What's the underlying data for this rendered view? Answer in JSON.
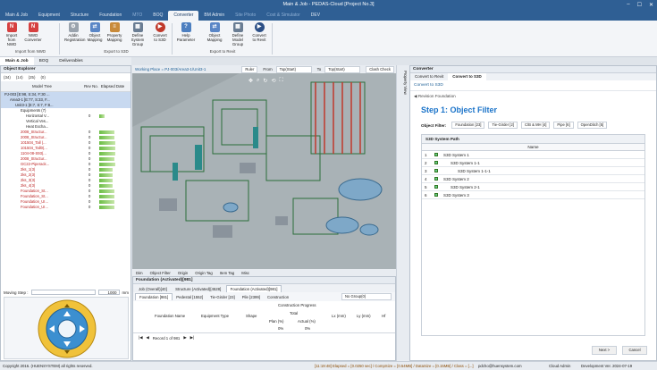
{
  "window": {
    "title": "Main & Job - PEDAS-Cloud [Project No.3]",
    "controls": [
      "–",
      "☐",
      "✕"
    ]
  },
  "menu": {
    "items": [
      "Main & Job",
      "Equipment",
      "Structure",
      "Foundation",
      "MTO",
      "BOQ",
      "Converter",
      "BM Admin",
      "Site Photo",
      "Cost & Simulator",
      "DEV"
    ],
    "active": "Converter"
  },
  "ribbon": {
    "groups": [
      {
        "label": "Import from NWD",
        "buttons": [
          "Import from NWD",
          "NWD Converter"
        ]
      },
      {
        "label": "Export to S3D",
        "buttons": [
          "Addin Registration",
          "Object Mapping",
          "Property Mapping",
          "Define System Group",
          "Convert to S3D"
        ]
      },
      {
        "label": "Export to Revit",
        "buttons": [
          "Help Parameter",
          "Object Mapping",
          "Define Model Group",
          "Convert to Revit"
        ]
      }
    ]
  },
  "doc_tabs": [
    "Main & Job",
    "BOQ",
    "Deliverables"
  ],
  "explorer": {
    "title": "Object Explorer",
    "counts": [
      "(34)",
      "(14)",
      "(25)",
      "(0)"
    ],
    "columns": [
      "Model Tree",
      "Rev No.",
      "Elapsed Date"
    ],
    "rows": [
      {
        "label": "PJ-003 [E:98, S:34, F:30 ...",
        "bar": 0
      },
      {
        "label": "Area3-1 [E:77, S:33, F...",
        "bar": 0
      },
      {
        "label": "Unit3-1 [E:7, S:7, F:8...",
        "bar": 0
      },
      {
        "label": "Equipments (7)",
        "bar": 0
      },
      {
        "label": "Horizontal V...",
        "rev": "0",
        "bar": 0.2
      },
      {
        "label": "Vertical Ves...",
        "bar": 0
      },
      {
        "label": "Heat Excha...",
        "bar": 0
      },
      {
        "label": "2008_Structur...",
        "rev": "0",
        "bar": 0.55
      },
      {
        "label": "2008_Structur...",
        "rev": "0",
        "bar": 0.55
      },
      {
        "label": "101504_Tall (...",
        "rev": "0",
        "bar": 0.6
      },
      {
        "label": "101504_Tall0(...",
        "rev": "0",
        "bar": 0.6
      },
      {
        "label": "1104-08-S93(...",
        "rev": "0",
        "bar": 0.6
      },
      {
        "label": "2008_Structur...",
        "rev": "0",
        "bar": 0.55
      },
      {
        "label": "GC22-Piperack...",
        "rev": "0",
        "bar": 0.6
      },
      {
        "label": "2ks_1(3)",
        "rev": "0",
        "bar": 0.5
      },
      {
        "label": "2ks_2(3)",
        "rev": "0",
        "bar": 0.5
      },
      {
        "label": "2ks_3(3)",
        "rev": "0",
        "bar": 0.5
      },
      {
        "label": "2ks_4(3)",
        "rev": "0",
        "bar": 0.5
      },
      {
        "label": "Foundation_St...",
        "rev": "0",
        "bar": 0.55
      },
      {
        "label": "Foundation_St...",
        "rev": "0",
        "bar": 0.55
      },
      {
        "label": "Foundation_UI...",
        "rev": "0",
        "bar": 0.55
      },
      {
        "label": "Foundation_UI...",
        "rev": "0",
        "bar": 0.55
      }
    ],
    "moving_step_label": "Moving Step :",
    "moving_step_value": "1000",
    "moving_step_unit": "mm"
  },
  "viewport": {
    "breadcrumb": "Working Place = PJ-003/Area3-1/Unit3-1",
    "ruler": "Ruler",
    "from_label": "From",
    "from_value": "Top(Start)",
    "to_label": "To",
    "to_value": "Top(Start)",
    "clash_check": "Clash Check",
    "bottom_tools": [
      "Dim",
      "Object Filter",
      "Origin",
      "Origin Tag",
      "Item Tag",
      "Misc"
    ]
  },
  "lower_panel": {
    "title": "Foundation (Activated)[981]",
    "tabs1": [
      "Job (Overall)[40]",
      "Structure (Activated)[4528]",
      "Foundation (Activated)[981]"
    ],
    "tabs2": [
      "Foundation [981]",
      "Pedestal [1552]",
      "Tie-Girder [23]",
      "Pile [2399]",
      "Construction"
    ],
    "group": "No Group(0)",
    "columns": [
      "Foundation Name",
      "Equipment Type",
      "Shape",
      "Construction Progress",
      "Total",
      "Plan (%)",
      "Actual (%)",
      "Lx (mm)",
      "Ly (mm)",
      "Hf"
    ],
    "plan_value": "0%",
    "actual_value": "0%",
    "record": "Record 1 of 981"
  },
  "right_panel": {
    "tabs": [
      "Converter",
      "Convert to Revit",
      "Convert to S3D"
    ],
    "active_tab": "Convert to S3D",
    "revision": "Revision Foundation",
    "step_title": "Step 1: Object Filter",
    "filter_label": "Object Filter:",
    "filters": [
      "Foundation [23]",
      "Tie-Girder [2]",
      "C/B & MH [4]",
      "Pipe [6]",
      "OpenDitch [5]"
    ],
    "section_title": "S3D System Path",
    "col_name": "Name",
    "systems": [
      {
        "no": "1",
        "name": "S3D System 1",
        "indent": 0
      },
      {
        "no": "2",
        "name": "S3D System 1-1",
        "indent": 1
      },
      {
        "no": "3",
        "name": "S3D System 1-1-1",
        "indent": 2
      },
      {
        "no": "4",
        "name": "S3D System 2",
        "indent": 0
      },
      {
        "no": "5",
        "name": "S3D System 2-1",
        "indent": 1
      },
      {
        "no": "6",
        "name": "S3D System 3",
        "indent": 0
      }
    ],
    "next": "Next >",
    "cancel": "Cancel"
  },
  "side_strip": "Property View",
  "status": {
    "copyright": "Copyright 2016. (HUENSYSTEM) all rights reserved.",
    "metrics": "[11:19:48] Elapsed = [0.0250 sec] / CompSize = [0.54MB] / DataSize = [0.15MB] / Class = [...]",
    "user": "pdcho@huensystem.com",
    "role": "Cloud Admin",
    "version": "Development Ver. 2024-07-19"
  }
}
